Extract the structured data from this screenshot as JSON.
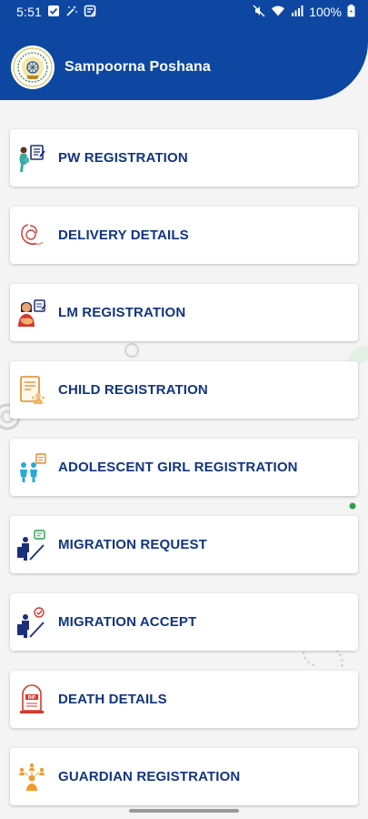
{
  "status_bar": {
    "time": "5:51",
    "battery": "100%",
    "left_icons": [
      "check-box-icon",
      "magic-wand-icon",
      "notes-icon"
    ],
    "right_icons": [
      "mute-icon",
      "wifi-icon",
      "signal-icon",
      "battery-icon"
    ]
  },
  "header": {
    "title": "Sampoorna Poshana",
    "logo_icon": "government-emblem-icon",
    "background_color": "#0d47a1"
  },
  "menu": {
    "items": [
      {
        "label": "PW REGISTRATION",
        "icon": "pregnant-woman-form-icon"
      },
      {
        "label": "DELIVERY DETAILS",
        "icon": "mother-baby-icon"
      },
      {
        "label": "LM REGISTRATION",
        "icon": "lactating-mother-icon"
      },
      {
        "label": "CHILD REGISTRATION",
        "icon": "child-document-icon"
      },
      {
        "label": "ADOLESCENT GIRL REGISTRATION",
        "icon": "adolescent-girls-icon"
      },
      {
        "label": "MIGRATION REQUEST",
        "icon": "traveler-luggage-icon"
      },
      {
        "label": "MIGRATION ACCEPT",
        "icon": "traveler-accept-icon"
      },
      {
        "label": "DEATH DETAILS",
        "icon": "rip-tombstone-icon"
      },
      {
        "label": "GUARDIAN REGISTRATION",
        "icon": "guardian-group-icon"
      }
    ],
    "label_color": "#12357f"
  }
}
